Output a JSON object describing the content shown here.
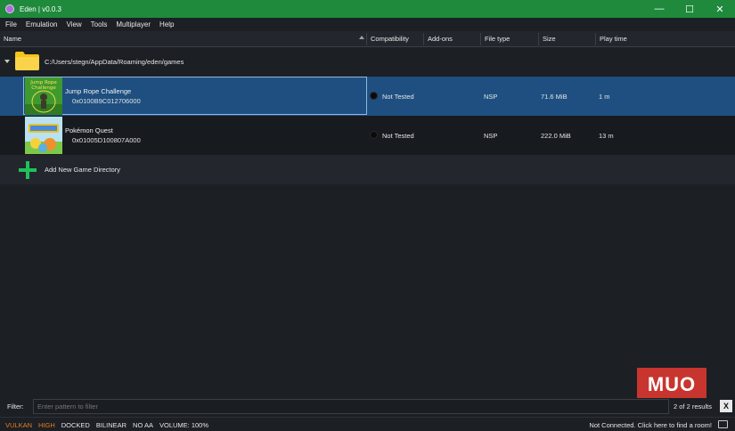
{
  "window": {
    "title": "Eden | v0.0.3",
    "controls": [
      "minimize",
      "maximize",
      "close"
    ]
  },
  "menu": [
    "File",
    "Emulation",
    "View",
    "Tools",
    "Multiplayer",
    "Help"
  ],
  "columns": {
    "name": "Name",
    "compatibility": "Compatibility",
    "addons": "Add-ons",
    "filetype": "File type",
    "size": "Size",
    "playtime": "Play time"
  },
  "directory": {
    "path": "C:/Users/stegn/AppData/Roaming/eden/games"
  },
  "games": [
    {
      "title": "Jump Rope Challenge",
      "id": "0x0100B9C012706000",
      "thumb_text": "Jump Rope Challenge",
      "compatibility": "Not Tested",
      "filetype": "NSP",
      "size": "71.6 MiB",
      "playtime": "1 m",
      "selected": true
    },
    {
      "title": "Pokémon Quest",
      "id": "0x01005D100807A000",
      "compatibility": "Not Tested",
      "filetype": "NSP",
      "size": "222.0 MiB",
      "playtime": "13 m",
      "selected": false
    }
  ],
  "add_directory_label": "Add New Game Directory",
  "filter": {
    "label": "Filter:",
    "placeholder": "Enter pattern to filter",
    "results": "2 of 2 results",
    "clear": "X"
  },
  "watermark": "MUO",
  "status": {
    "left": [
      "VULKAN",
      "HIGH",
      "DOCKED",
      "BILINEAR",
      "NO AA",
      "VOLUME: 100%"
    ],
    "right": "Not Connected. Click here to find a room!"
  },
  "colors": {
    "titlebar": "#1f8a3c",
    "selection": "#1e4f80",
    "accent_green": "#1fc25a",
    "status_orange": "#e67e22"
  }
}
